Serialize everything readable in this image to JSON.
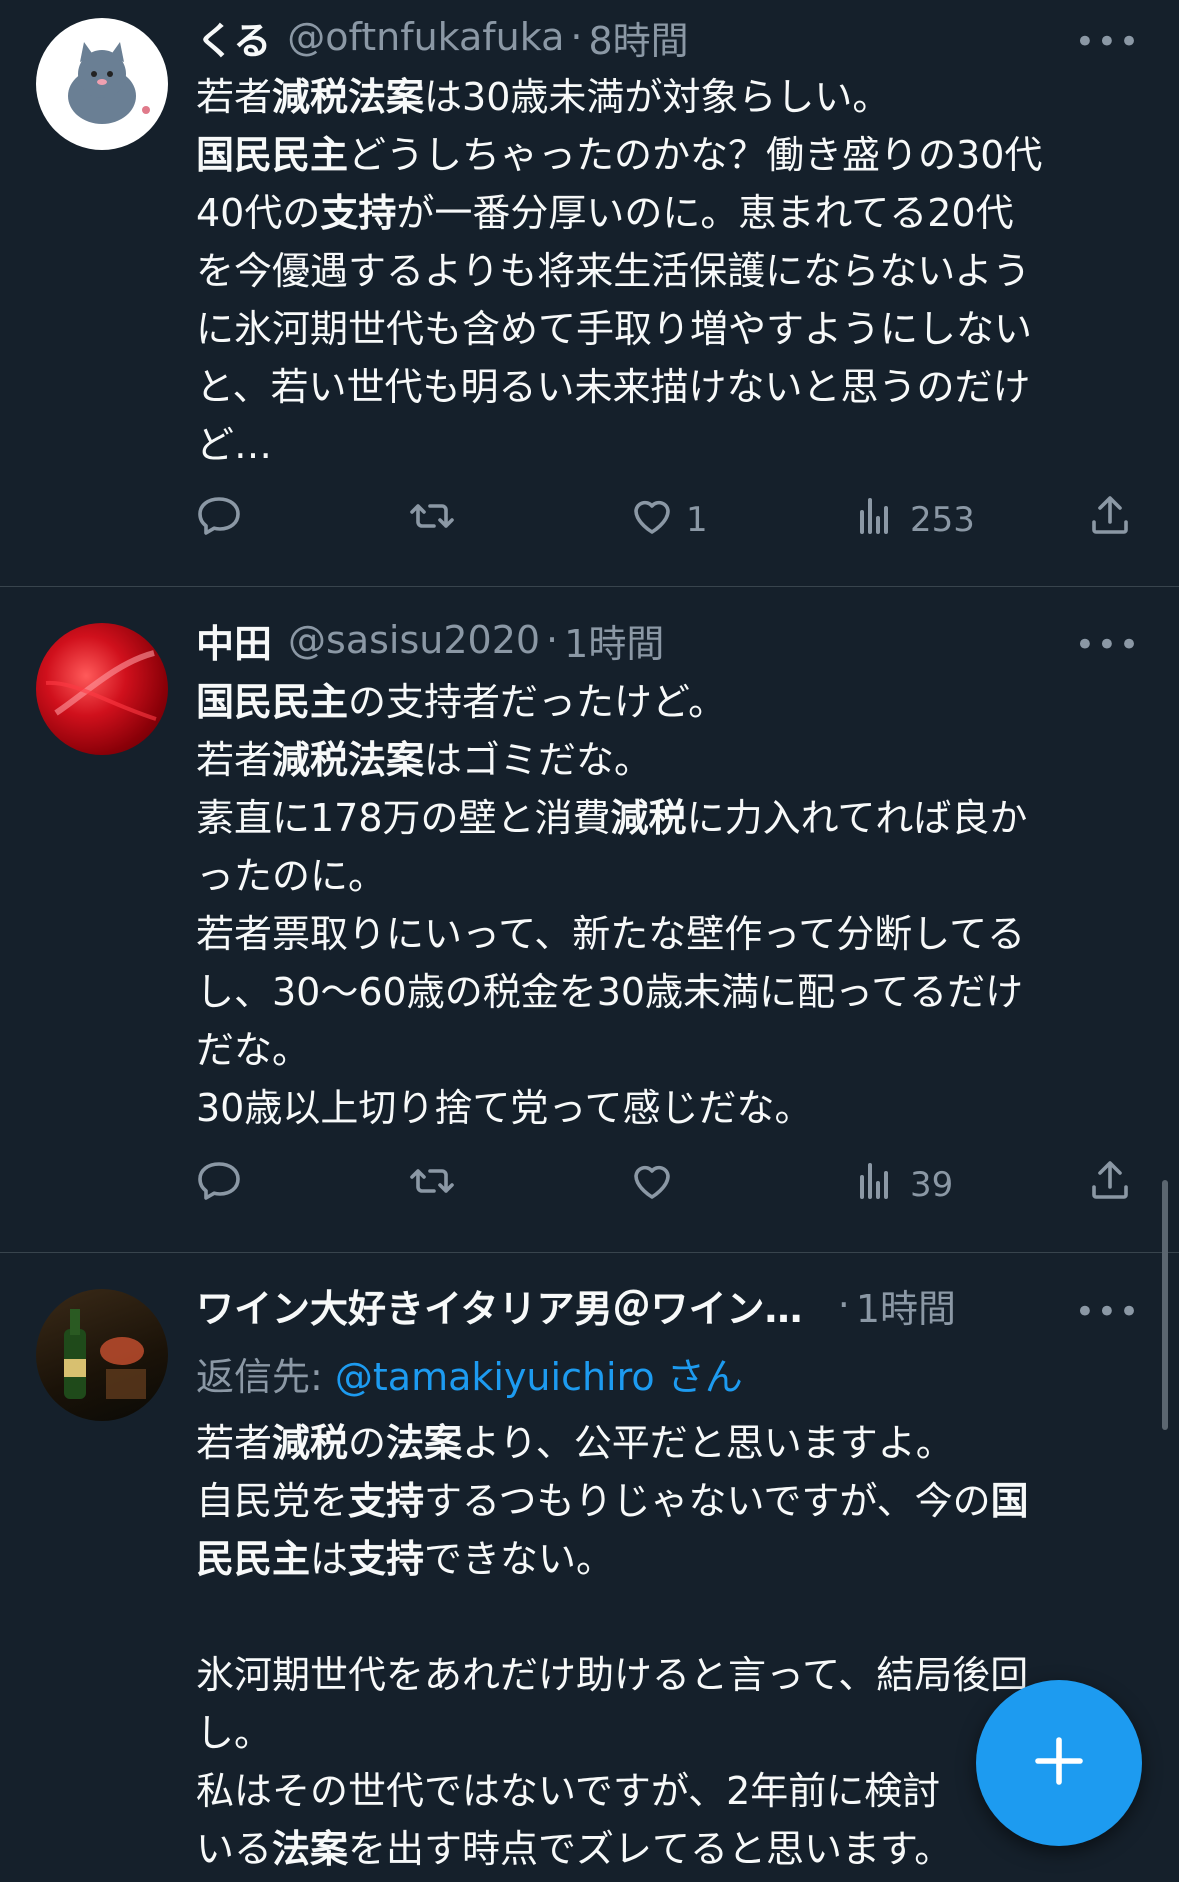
{
  "tweets": [
    {
      "name": "くる",
      "handle": "@oftnfukafuka",
      "time": "8時間",
      "more": "•••",
      "lines": [
        [
          {
            "t": "若者"
          },
          {
            "t": "減税法案",
            "b": true
          },
          {
            "t": "は30歳未満が対象らしい。"
          }
        ],
        [
          {
            "t": "国民民主",
            "b": true
          },
          {
            "t": "どうしちゃったのかな？働き盛りの30代"
          }
        ],
        [
          {
            "t": "40代の"
          },
          {
            "t": "支持",
            "b": true
          },
          {
            "t": "が一番分厚いのに。恵まれてる20代"
          }
        ],
        [
          {
            "t": "を今優遇するよりも将来生活保護にならないよう"
          }
        ],
        [
          {
            "t": "に氷河期世代も含めて手取り増やすようにしない"
          }
        ],
        [
          {
            "t": "と、若い世代も明るい未来描けないと思うのだけ"
          }
        ],
        [
          {
            "t": "ど…"
          }
        ]
      ],
      "likes": "1",
      "views": "253"
    },
    {
      "name": "中田",
      "handle": "@sasisu2020",
      "time": "1時間",
      "more": "•••",
      "lines": [
        [
          {
            "t": "国民民主",
            "b": true
          },
          {
            "t": "の支持者だったけど。"
          }
        ],
        [
          {
            "t": "若者"
          },
          {
            "t": "減税法案",
            "b": true
          },
          {
            "t": "はゴミだな。"
          }
        ],
        [
          {
            "t": "素直に178万の壁と消費"
          },
          {
            "t": "減税",
            "b": true
          },
          {
            "t": "に力入れてれば良か"
          }
        ],
        [
          {
            "t": "ったのに。"
          }
        ],
        [
          {
            "t": "若者票取りにいって、新たな壁作って分断してる"
          }
        ],
        [
          {
            "t": "し、30〜60歳の税金を30歳未満に配ってるだけ"
          }
        ],
        [
          {
            "t": "だな。"
          }
        ],
        [
          {
            "t": "30歳以上切り捨て党って感じだな。"
          }
        ]
      ],
      "likes": "",
      "views": "39"
    },
    {
      "name": "ワイン大好きイタリア男＠ワインエ…",
      "handle": "",
      "time": "1時間",
      "more": "•••",
      "reply_prefix": "返信先: ",
      "reply_handle": "@tamakiyuichiro",
      "reply_suffix": " さん",
      "lines": [
        [
          {
            "t": "若者"
          },
          {
            "t": "減税",
            "b": true
          },
          {
            "t": "の"
          },
          {
            "t": "法案",
            "b": true
          },
          {
            "t": "より、公平だと思いますよ。"
          }
        ],
        [
          {
            "t": "自民党を"
          },
          {
            "t": "支持",
            "b": true
          },
          {
            "t": "するつもりじゃないですが、今の"
          },
          {
            "t": "国",
            "b": true
          }
        ],
        [
          {
            "t": "民民主",
            "b": true
          },
          {
            "t": "は"
          },
          {
            "t": "支持",
            "b": true
          },
          {
            "t": "できない。"
          }
        ],
        [
          {
            "t": ""
          }
        ],
        [
          {
            "t": "氷河期世代をあれだけ助けると言って、結局後回"
          }
        ],
        [
          {
            "t": "し。"
          }
        ],
        [
          {
            "t": "私はその世代ではないですが、2年前に検討"
          }
        ],
        [
          {
            "t": "いる"
          },
          {
            "t": "法案",
            "b": true
          },
          {
            "t": "を出す時点でズレてると思います。"
          }
        ]
      ]
    }
  ],
  "icons": [
    "reply-icon",
    "retweet-icon",
    "heart-icon",
    "views-icon",
    "share-icon",
    "compose-plus-icon"
  ],
  "colors": {
    "background": "#15202b",
    "text": "#f7f9f9",
    "muted": "#8b98a5",
    "accent": "#1d9bf0",
    "divider": "#38444d"
  }
}
